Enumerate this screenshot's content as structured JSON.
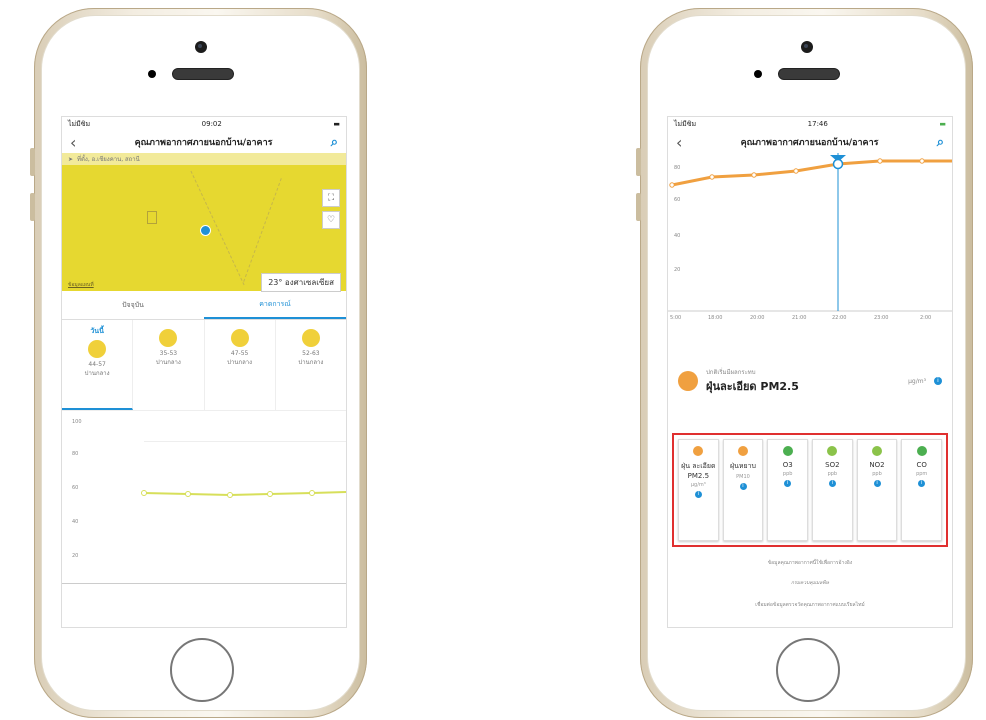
{
  "left_phone": {
    "status": {
      "carrier": "ไม่มีซิม",
      "time": "09:02"
    },
    "nav": {
      "title": "คุณภาพอากาศภายนอกบ้าน/อาคาร"
    },
    "location": {
      "text": "ที่ตั้ง, อ.เชียงคาน, สถานี"
    },
    "map": {
      "temperature": "23° องศาเซลเซียส",
      "legal": "ข้อมูลแผนที่"
    },
    "tabs": [
      {
        "label": "ปัจจุบัน"
      },
      {
        "label": "คาดการณ์"
      }
    ],
    "forecast": [
      {
        "label": "วันนี้",
        "range": "44-57",
        "desc": "ปานกลาง"
      },
      {
        "label": "",
        "range": "35-53",
        "desc": "ปานกลาง"
      },
      {
        "label": "",
        "range": "47-55",
        "desc": "ปานกลาง"
      },
      {
        "label": "",
        "range": "52-63",
        "desc": "ปานกลาง"
      }
    ],
    "chart_y_labels": [
      "100",
      "80",
      "60",
      "40",
      "20"
    ]
  },
  "right_phone": {
    "status": {
      "carrier": "ไม่มีซิม",
      "time": "17:46"
    },
    "nav": {
      "title": "คุณภาพอากาศภายนอกบ้าน/อาคาร"
    },
    "chart_y_labels": [
      "80",
      "60",
      "40",
      "20"
    ],
    "chart_x_labels": [
      "5:00",
      "18:00",
      "20:00",
      "21:00",
      "22:00",
      "23:00",
      "2:00"
    ],
    "quality": {
      "status_label": "ปกติเริ่มมีผลกระทบ",
      "pollutant": "ฝุ่นละเอียด PM2.5",
      "value": "µg/m³"
    },
    "pollutants": [
      {
        "name": "ฝุ่น ละเอียด PM2.5",
        "unit": "µg/m³",
        "color": "#f0a040"
      },
      {
        "name": "ฝุ่นหยาบ",
        "unit": "PM10",
        "color": "#f0a040"
      },
      {
        "name": "O3",
        "unit": "ppb",
        "color": "#4caf50"
      },
      {
        "name": "SO2",
        "unit": "ppb",
        "color": "#8bc34a"
      },
      {
        "name": "NO2",
        "unit": "ppb",
        "color": "#8bc34a"
      },
      {
        "name": "CO",
        "unit": "ppm",
        "color": "#4caf50"
      }
    ],
    "footer": {
      "line1": "ข้อมูลคุณภาพอากาศนี้ใช้เพื่อการอ้างอิง",
      "line2": "กรมควบคุมมลพิษ",
      "line3": "เชื่อมต่อข้อมูลตรวจวัดคุณภาพอากาศแบบเรียลไทม์"
    }
  }
}
